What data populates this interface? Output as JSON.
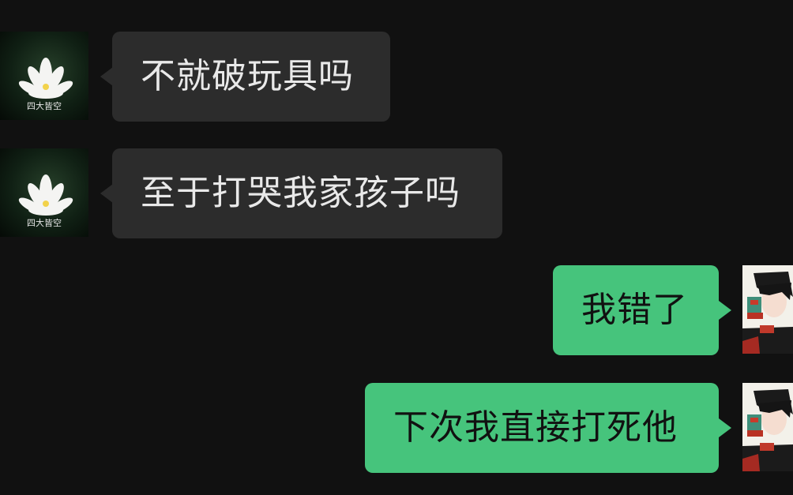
{
  "theme": {
    "background": "#111111",
    "incoming_bubble": "#2c2c2c",
    "outgoing_bubble": "#46c47c",
    "incoming_text": "#e9e9e9",
    "outgoing_text": "#111111"
  },
  "contact": {
    "avatar_icon": "lotus-avatar-icon",
    "avatar_caption": "四大皆空"
  },
  "self": {
    "avatar_icon": "anime-boy-avatar-icon"
  },
  "messages": [
    {
      "sender": "contact",
      "text": "不就破玩具吗"
    },
    {
      "sender": "contact",
      "text": "至于打哭我家孩子吗"
    },
    {
      "sender": "self",
      "text": "我错了"
    },
    {
      "sender": "self",
      "text": "下次我直接打死他"
    }
  ]
}
